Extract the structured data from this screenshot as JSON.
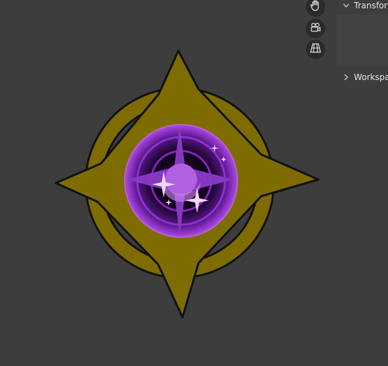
{
  "viewport": {
    "background": "#3d3d3d"
  },
  "emblem": {
    "colors": {
      "gold": "#7e6c00",
      "outline": "#111111",
      "purple_ring": "#8a22c8",
      "purple_dark": "#1a0428",
      "purple_mid": "#5a1890",
      "purple_light": "#c06ae8",
      "sparkle": "#f0d8ff"
    }
  },
  "gizmo": {
    "buttons": [
      {
        "icon": "hand-pan-icon"
      },
      {
        "icon": "camera-icon"
      },
      {
        "icon": "grid-perspective-icon"
      }
    ]
  },
  "panel": {
    "transform_label": "Transform",
    "workspace_label": "Workspace",
    "transform_expanded": true,
    "workspace_expanded": false
  }
}
